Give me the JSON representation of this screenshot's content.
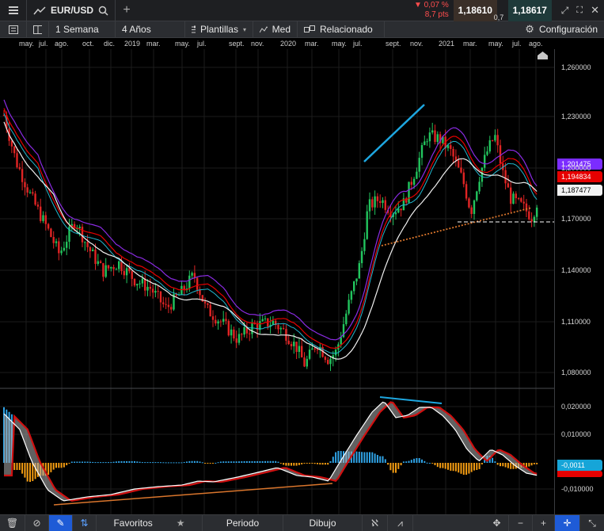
{
  "topbar": {
    "symbol": "EUR/USD",
    "change_pct": "0,07 %",
    "change_pts": "8,7 pts",
    "bid": "1,18610",
    "spread": "0,7",
    "ask": "1,18617",
    "colors": {
      "bid_bg": "#3a2f28",
      "ask_bg": "#1f3a3a",
      "down": "#ff4d4d"
    }
  },
  "toolbar": {
    "interval": "1 Semana",
    "range": "4 Años",
    "templates": "Plantillas",
    "indicator": "Med",
    "related": "Relacionado",
    "settings": "Configuración"
  },
  "time_axis": [
    "may.",
    "jul.",
    "ago.",
    "oct.",
    "dic.",
    "2019",
    "mar.",
    "may.",
    "jul.",
    "sept.",
    "nov.",
    "2020",
    "mar.",
    "may.",
    "jul.",
    "sept.",
    "nov.",
    "2021",
    "mar.",
    "may.",
    "jul.",
    "ago."
  ],
  "price_axis": [
    "1,260000",
    "1,230000",
    "1,200000",
    "1,170000",
    "1,140000",
    "1,110000",
    "1,080000"
  ],
  "price_badges": {
    "purple": "1,201475",
    "red": "1,194834",
    "white": "1,187477"
  },
  "macd_axis": [
    "0,020000",
    "0,010000",
    "-0,010000"
  ],
  "macd_badge": "-0,0011",
  "bottombar": {
    "favorites": "Favoritos",
    "period": "Periodo",
    "drawing": "Dibujo"
  }
}
